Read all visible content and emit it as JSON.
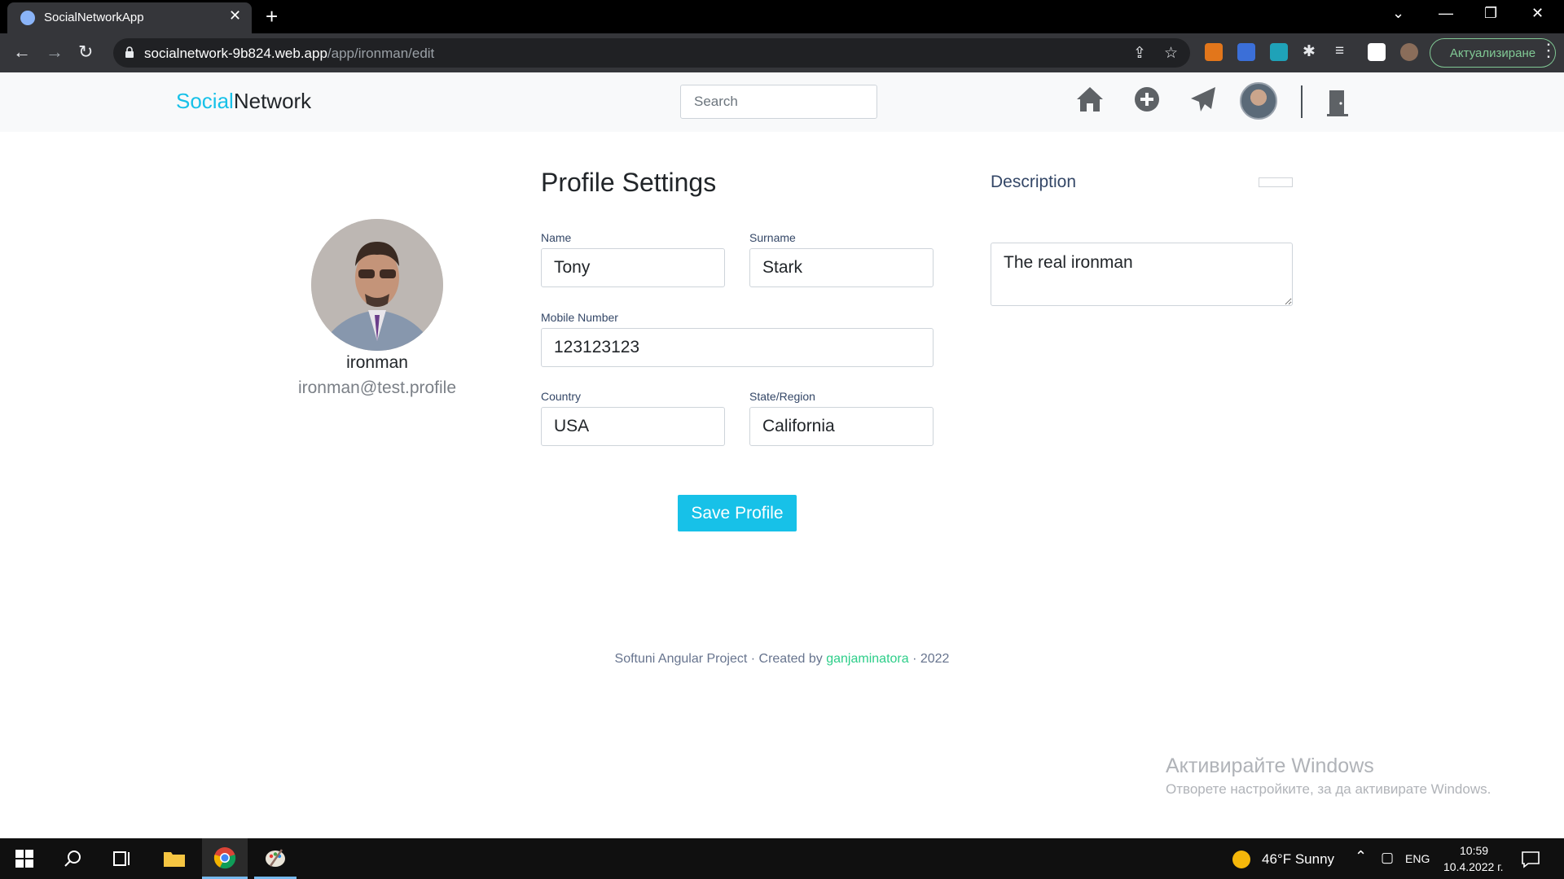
{
  "browser": {
    "tab_title": "SocialNetworkApp",
    "url_host": "socialnetwork-9b824.web.app",
    "url_path": "/app/ironman/edit",
    "update_label": "Актуализиране"
  },
  "header": {
    "brand_part1": "Social",
    "brand_part2": "Network",
    "search_placeholder": "Search",
    "accent_color": "#17c1e8"
  },
  "profile": {
    "username": "ironman",
    "email": "ironman@test.profile"
  },
  "form": {
    "title": "Profile Settings",
    "fields": [
      {
        "label": "Name",
        "value": "Tony"
      },
      {
        "label": "Surname",
        "value": "Stark"
      },
      {
        "label": "Mobile Number",
        "value": "123123123"
      },
      {
        "label": "Country",
        "value": "USA"
      },
      {
        "label": "State/Region",
        "value": "California"
      }
    ],
    "save_label": "Save Profile"
  },
  "description": {
    "title": "Description",
    "value": "The real ironman"
  },
  "footer": {
    "text_before": "Softuni Angular Project · Created by ",
    "author": "ganjaminatora",
    "text_after": " · 2022"
  },
  "watermark": {
    "line1": "Активирайте Windows",
    "line2": "Отворете настройките, за да активирате Windows."
  },
  "taskbar": {
    "weather": "46°F  Sunny",
    "language": "ENG",
    "time": "10:59",
    "date": "10.4.2022 г."
  }
}
